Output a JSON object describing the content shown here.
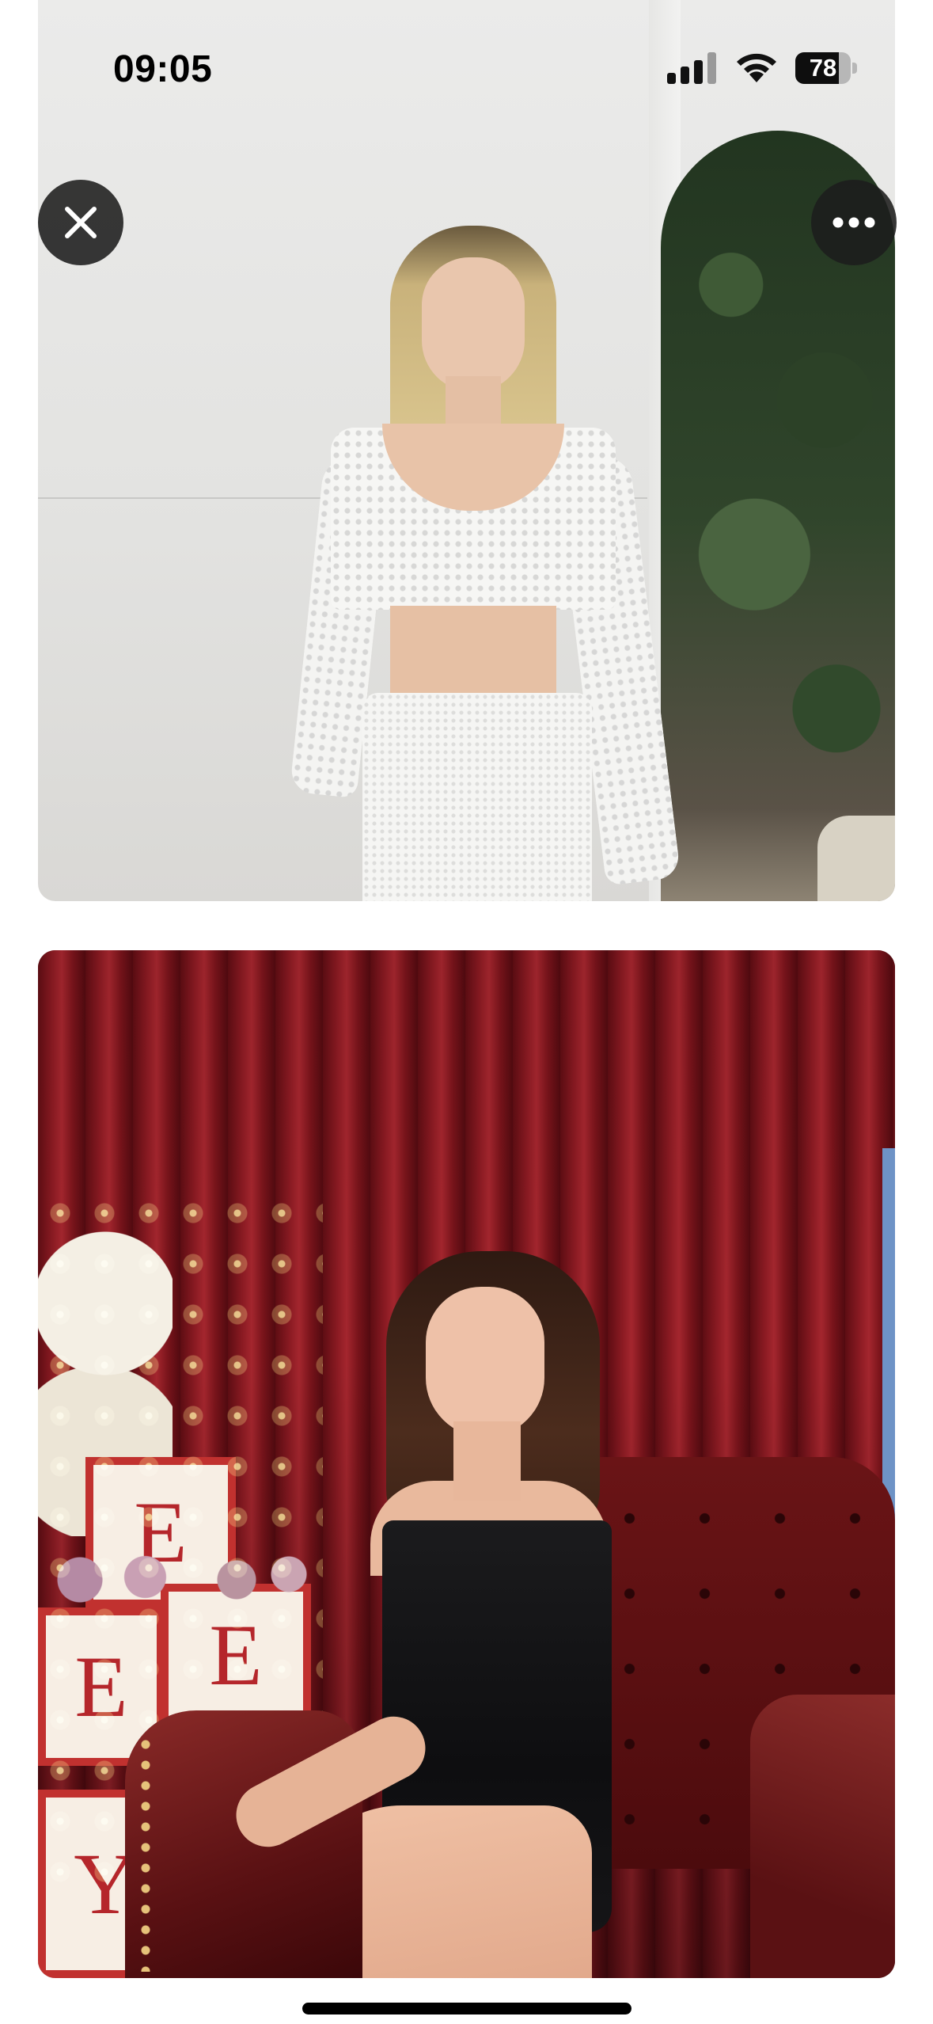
{
  "status_bar": {
    "time": "09:05",
    "signal_icon": "cellular-signal-icon",
    "wifi_icon": "wifi-icon",
    "battery_percent": "78",
    "battery_level": 0.78
  },
  "overlay": {
    "close_icon": "close-icon",
    "more_icon": "more-horizontal-icon"
  },
  "photo_2": {
    "block_letters": [
      "E",
      "E",
      "E",
      "Y"
    ]
  },
  "colors": {
    "overlay_button": "#1c1c1c",
    "background": "#ffffff"
  }
}
